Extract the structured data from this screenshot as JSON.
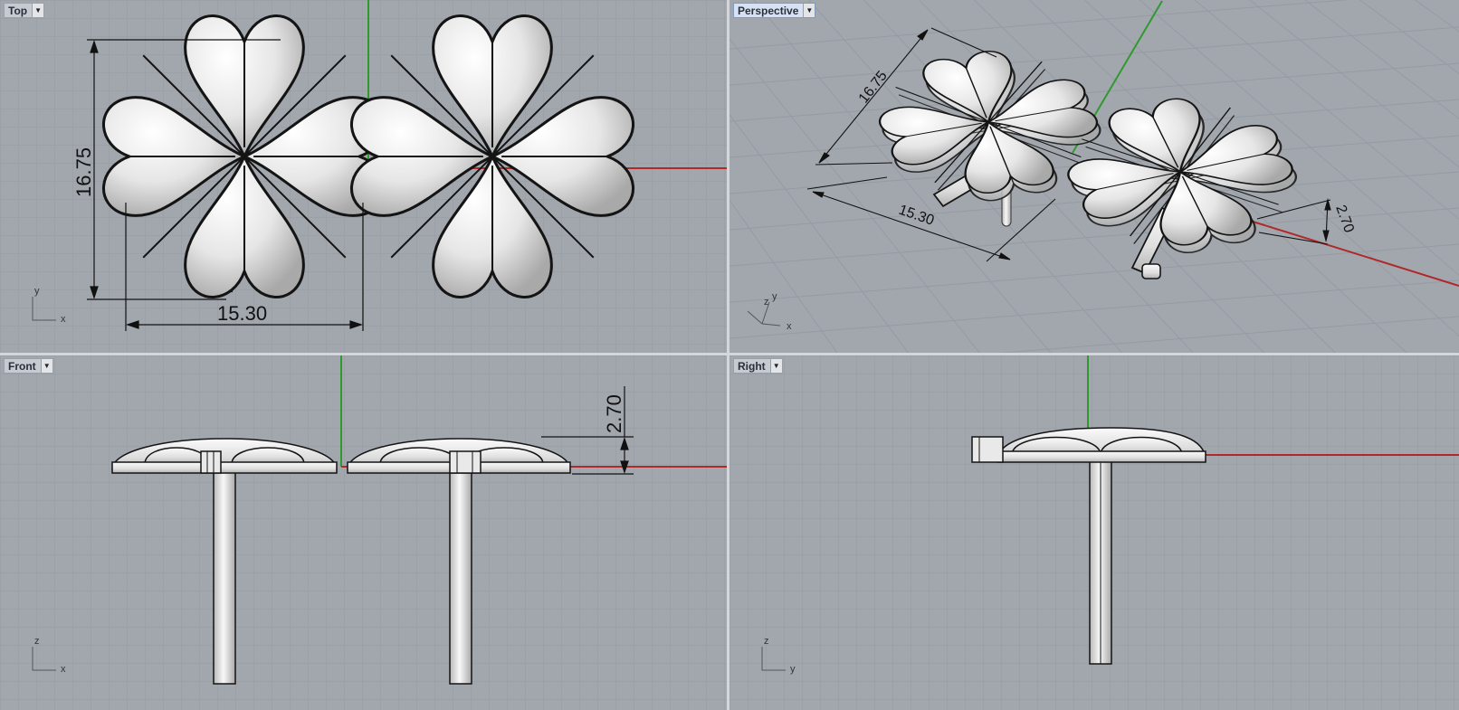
{
  "viewports": {
    "top": {
      "label": "Top",
      "dim_height": "16.75",
      "dim_width": "15.30",
      "axis_a": "y",
      "axis_b": "x"
    },
    "perspective": {
      "label": "Perspective",
      "dim_height": "16.75",
      "dim_width": "15.30",
      "dim_depth": "2.70",
      "axis_z": "z",
      "axis_y": "y",
      "axis_x": "x"
    },
    "front": {
      "label": "Front",
      "dim_depth": "2.70",
      "axis_a": "z",
      "axis_b": "x"
    },
    "right": {
      "label": "Right",
      "axis_a": "z",
      "axis_b": "y"
    }
  },
  "colors": {
    "viewport_bg": "#a2a7ae",
    "grid_minor": "#989da5",
    "grid_major": "#8a8f97",
    "x_axis": "#b02828",
    "y_axis": "#2e9a2e",
    "model_fill": "#ebebeb",
    "model_edge": "#141414",
    "active_label": "#d6e2f3"
  },
  "icons": {
    "dropdown": "triangle-down-icon"
  }
}
